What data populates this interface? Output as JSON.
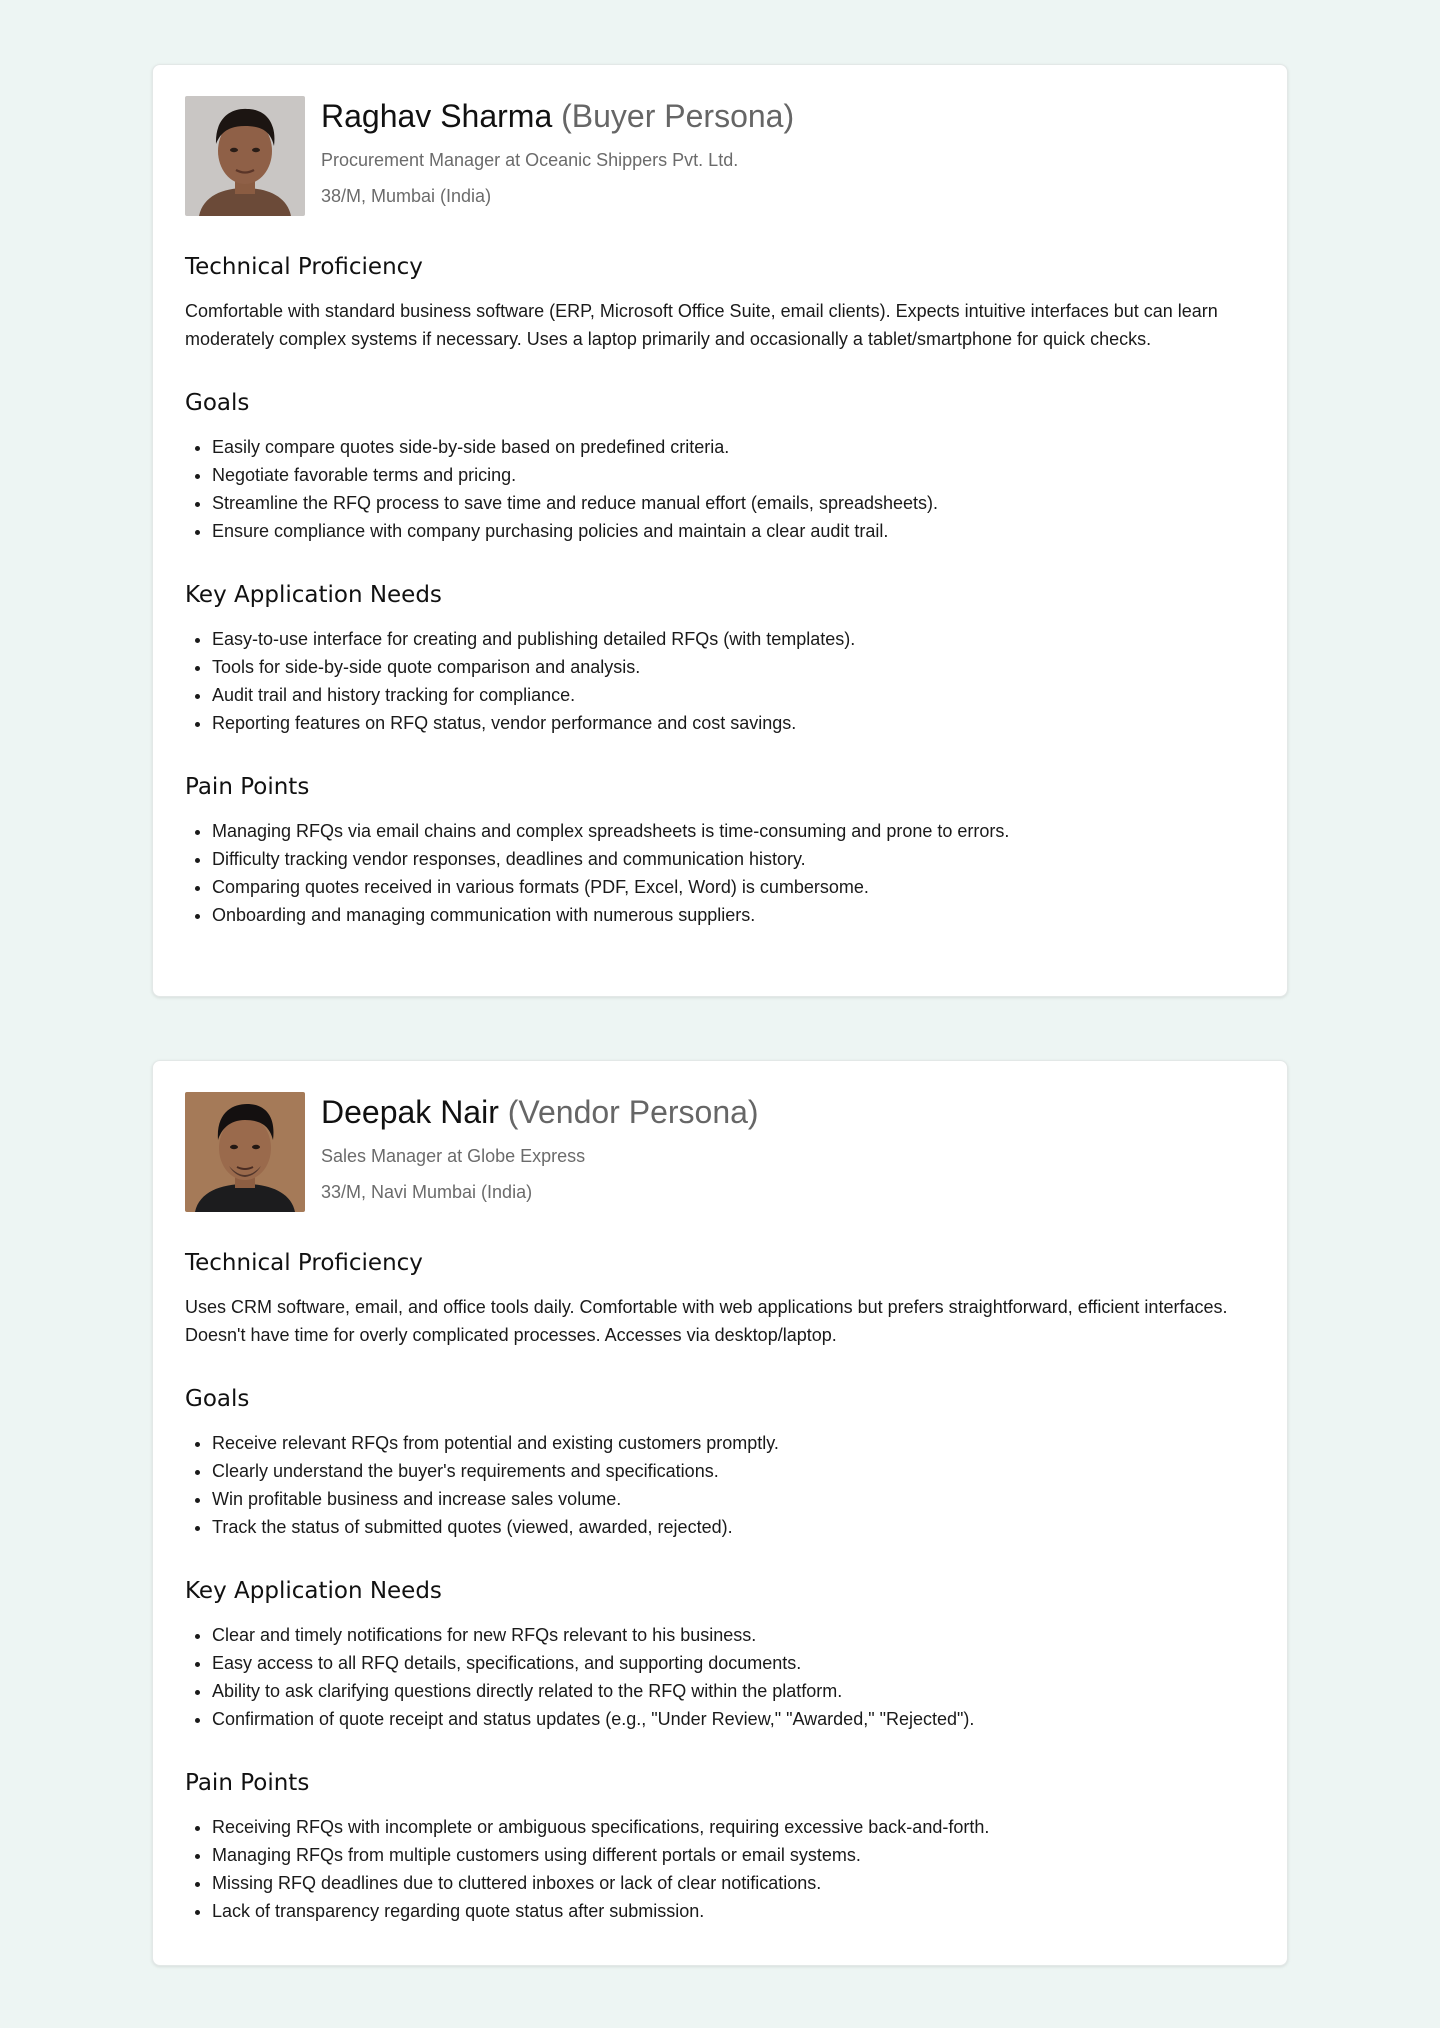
{
  "personas": [
    {
      "name": "Raghav Sharma",
      "persona_label": "(Buyer Persona)",
      "role": "Procurement Manager at Oceanic Shippers Pvt. Ltd.",
      "location": "38/M, Mumbai (India)",
      "avatar_bg": "#c9c6c4",
      "sections": {
        "tech_title": "Technical Proficiency",
        "tech_text": "Comfortable with standard business software (ERP, Microsoft Office Suite, email clients). Expects intuitive interfaces but can learn moderately complex systems if necessary. Uses a laptop primarily and occasionally a tablet/smartphone for quick checks.",
        "goals_title": "Goals",
        "goals": [
          "Easily compare quotes side-by-side based on predefined criteria.",
          "Negotiate favorable terms and pricing.",
          "Streamline the RFQ process to save time and reduce manual effort (emails, spreadsheets).",
          "Ensure compliance with company purchasing policies and maintain a clear audit trail."
        ],
        "needs_title": "Key Application Needs",
        "needs": [
          "Easy-to-use interface for creating and publishing detailed RFQs (with templates).",
          "Tools for side-by-side quote comparison and analysis.",
          "Audit trail and history tracking for compliance.",
          "Reporting features on RFQ status, vendor performance and cost savings."
        ],
        "pain_title": "Pain Points",
        "pain": [
          "Managing RFQs via email chains and complex spreadsheets is time-consuming and prone to errors.",
          "Difficulty tracking vendor responses, deadlines and communication history.",
          "Comparing quotes received in various formats (PDF, Excel, Word) is cumbersome.",
          "Onboarding and managing communication with numerous suppliers."
        ]
      }
    },
    {
      "name": "Deepak Nair",
      "persona_label": "(Vendor Persona)",
      "role": "Sales Manager at Globe Express",
      "location": "33/M, Navi Mumbai (India)",
      "avatar_bg": "#a57a58",
      "sections": {
        "tech_title": "Technical Proficiency",
        "tech_text": "Uses CRM software, email, and office tools daily. Comfortable with web applications but prefers straightforward, efficient interfaces. Doesn't have time for overly complicated processes. Accesses via desktop/laptop.",
        "goals_title": "Goals",
        "goals": [
          "Receive relevant RFQs from potential and existing customers promptly.",
          "Clearly understand the buyer's requirements and specifications.",
          "Win profitable business and increase sales volume.",
          "Track the status of submitted quotes (viewed, awarded, rejected)."
        ],
        "needs_title": "Key Application Needs",
        "needs": [
          "Clear and timely notifications for new RFQs relevant to his business.",
          "Easy access to all RFQ details, specifications, and supporting documents.",
          "Ability to ask clarifying questions directly related to the RFQ within the platform.",
          "Confirmation of quote receipt and status updates (e.g., \"Under Review,\" \"Awarded,\" \"Rejected\")."
        ],
        "pain_title": "Pain Points",
        "pain": [
          "Receiving RFQs with incomplete or ambiguous specifications, requiring excessive back-and-forth.",
          "Managing RFQs from multiple customers using different portals or email systems.",
          "Missing RFQ deadlines due to cluttered inboxes or lack of clear notifications.",
          "Lack of transparency regarding quote status after submission."
        ]
      }
    }
  ]
}
